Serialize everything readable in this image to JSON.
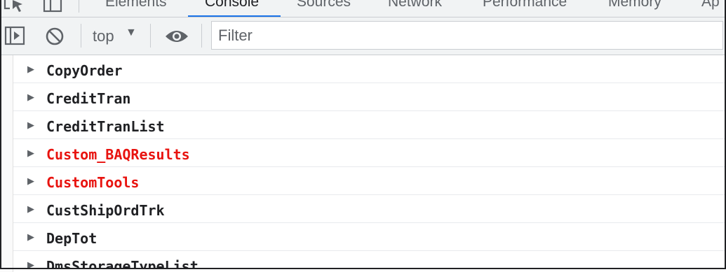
{
  "tabs": [
    {
      "label": "Elements",
      "active": false
    },
    {
      "label": "Console",
      "active": true
    },
    {
      "label": "Sources",
      "active": false
    },
    {
      "label": "Network",
      "active": false
    },
    {
      "label": "Performance",
      "active": false
    },
    {
      "label": "Memory",
      "active": false
    },
    {
      "label": "Ap",
      "active": false
    }
  ],
  "toolbar": {
    "context": "top",
    "filter_placeholder": "Filter"
  },
  "entries": [
    {
      "label": "CopyOrder",
      "color": "#202124"
    },
    {
      "label": "CreditTran",
      "color": "#202124"
    },
    {
      "label": "CreditTranList",
      "color": "#202124"
    },
    {
      "label": "Custom_BAQResults",
      "color": "#e8130f"
    },
    {
      "label": "CustomTools",
      "color": "#e8130f"
    },
    {
      "label": "CustShipOrdTrk",
      "color": "#202124"
    },
    {
      "label": "DepTot",
      "color": "#202124"
    },
    {
      "label": "DmsStorageTypeList",
      "color": "#202124"
    }
  ],
  "icons": {
    "inspect": "inspect-element-icon",
    "device": "device-toggle-icon",
    "sidebar": "show-sidebar-icon",
    "clear": "clear-console-icon",
    "eye": "live-expression-icon",
    "expand": "expand-triangle-icon"
  }
}
